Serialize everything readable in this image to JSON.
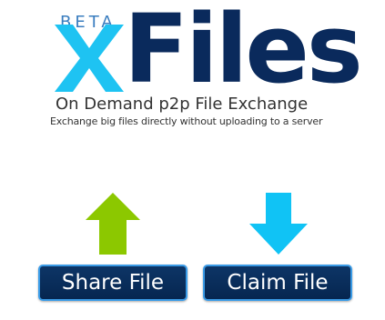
{
  "logo": {
    "beta_label": "BETA",
    "x_letter": "x",
    "files_word": "Files",
    "x_color": "#1ec3f2",
    "files_color": "#0a2a5c"
  },
  "tagline": "On Demand p2p File Exchange",
  "subline": "Exchange big files directly without uploading to a server",
  "actions": {
    "share": {
      "label": "Share File",
      "icon": "arrow-up-icon",
      "icon_color": "#8cc800"
    },
    "claim": {
      "label": "Claim File",
      "icon": "arrow-down-icon",
      "icon_color": "#10c3f5"
    }
  },
  "colors": {
    "button_bg": "#0a2d5e",
    "button_border": "#3a9be6",
    "button_text": "#ffffff"
  }
}
